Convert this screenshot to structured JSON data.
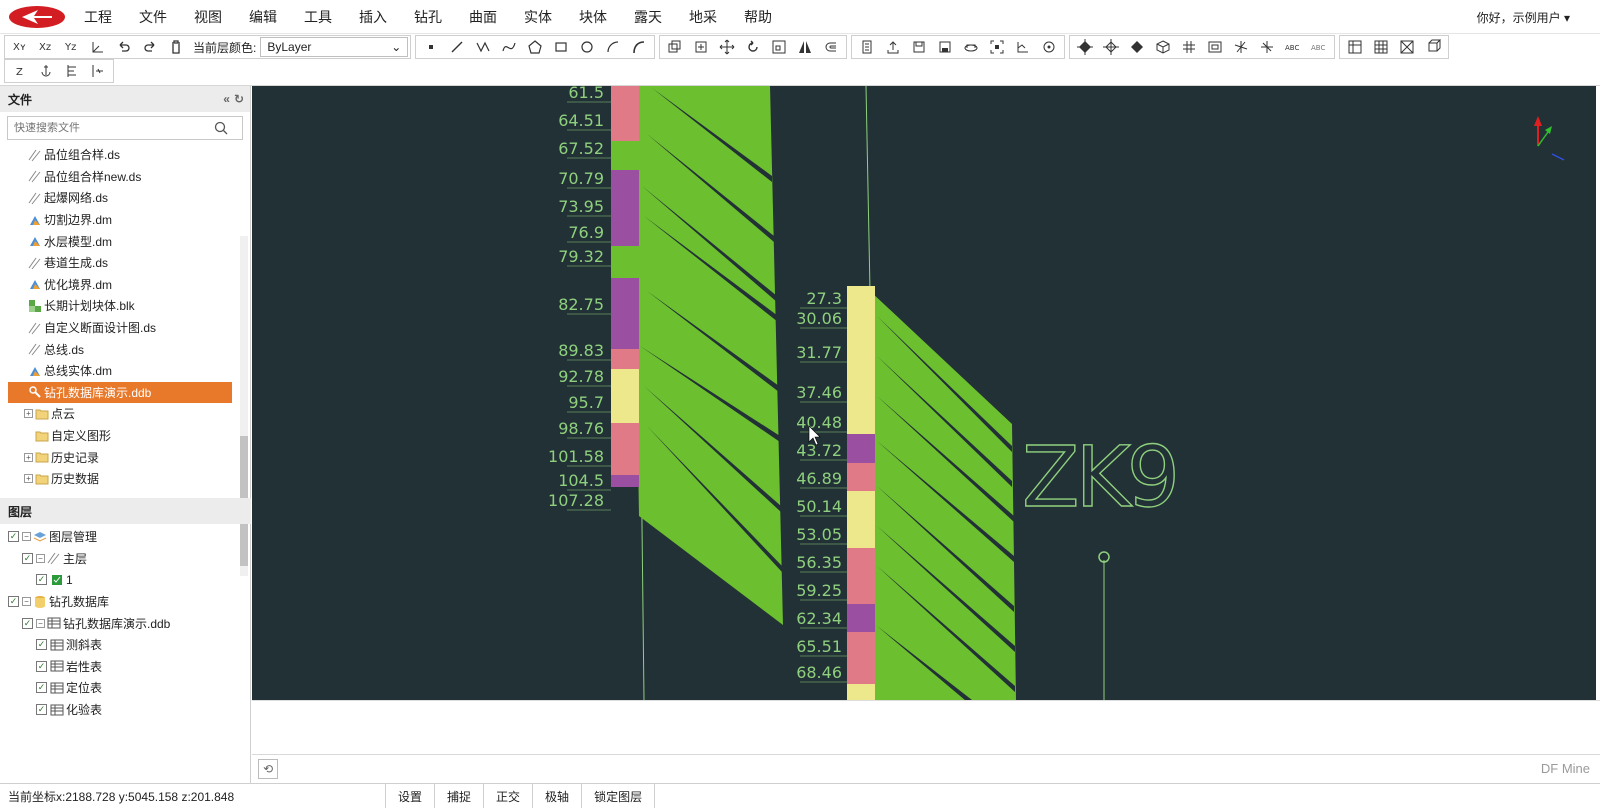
{
  "menu": {
    "items": [
      "工程",
      "文件",
      "视图",
      "编辑",
      "工具",
      "插入",
      "钻孔",
      "曲面",
      "实体",
      "块体",
      "露天",
      "地采",
      "帮助"
    ],
    "user": "你好，示例用户 ▾"
  },
  "toolbar": {
    "layer_color_label": "当前层颜色:",
    "layer_color_value": "ByLayer"
  },
  "file_panel": {
    "title": "文件",
    "search_placeholder": "快速搜索文件",
    "items": [
      {
        "name": "品位组合样.ds",
        "icon": "line-file"
      },
      {
        "name": "品位组合样new.ds",
        "icon": "line-file"
      },
      {
        "name": "起爆网络.ds",
        "icon": "line-file"
      },
      {
        "name": "切割边界.dm",
        "icon": "model-file"
      },
      {
        "name": "水层模型.dm",
        "icon": "model-file"
      },
      {
        "name": "巷道生成.ds",
        "icon": "line-file"
      },
      {
        "name": "优化境界.dm",
        "icon": "model-file"
      },
      {
        "name": "长期计划块体.blk",
        "icon": "block-file"
      },
      {
        "name": "自定义断面设计图.ds",
        "icon": "line-file"
      },
      {
        "name": "总线.ds",
        "icon": "line-file"
      },
      {
        "name": "总线实体.dm",
        "icon": "model-file"
      },
      {
        "name": "钻孔数据库演示.ddb",
        "icon": "db-file"
      },
      {
        "name": "点云",
        "icon": "folder"
      },
      {
        "name": "自定义图形",
        "icon": "folder"
      },
      {
        "name": "历史记录",
        "icon": "folder"
      },
      {
        "name": "历史数据",
        "icon": "folder"
      }
    ]
  },
  "layer_panel": {
    "title": "图层",
    "items": [
      {
        "label": "图层管理",
        "level": 0
      },
      {
        "label": "主层",
        "level": 1
      },
      {
        "label": "1",
        "level": 2
      },
      {
        "label": "钻孔数据库",
        "level": 0
      },
      {
        "label": "钻孔数据库演示.ddb",
        "level": 1
      },
      {
        "label": "测斜表",
        "level": 2
      },
      {
        "label": "岩性表",
        "level": 2
      },
      {
        "label": "定位表",
        "level": 2
      },
      {
        "label": "化验表",
        "level": 2
      }
    ]
  },
  "viewport": {
    "left_hole_depths": [
      "61.5",
      "64.51",
      "67.52",
      "70.79",
      "73.95",
      "76.9",
      "79.32",
      "82.75",
      "89.83",
      "92.78",
      "95.7",
      "98.76",
      "101.58",
      "104.5",
      "107.28"
    ],
    "right_hole_depths": [
      "27.3",
      "30.06",
      "31.77",
      "37.46",
      "40.48",
      "43.72",
      "46.89",
      "50.14",
      "53.05",
      "56.35",
      "59.25",
      "62.34",
      "65.51",
      "68.46"
    ],
    "hole_label": "ZK9",
    "colors": {
      "background": "#223135",
      "ore": "#6cbf2f",
      "pink": "#e07a87",
      "purple": "#9a4fa0",
      "yellow": "#ede88c",
      "depth_text": "#8fd07e"
    }
  },
  "command": {
    "brand": "DF Mine"
  },
  "status": {
    "coord": "当前坐标x:2188.728   y:5045.158   z:201.848",
    "buttons": [
      "设置",
      "捕捉",
      "正交",
      "极轴",
      "锁定图层"
    ]
  }
}
